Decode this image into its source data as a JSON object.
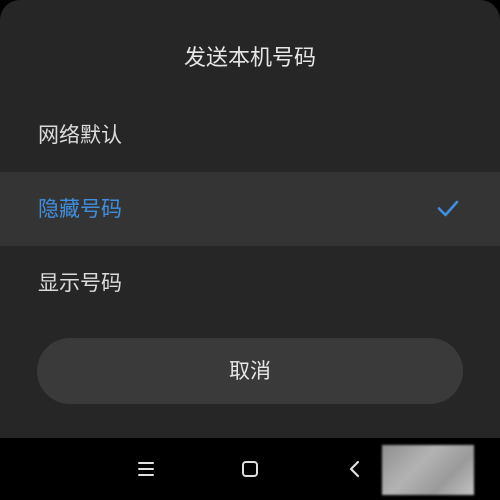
{
  "dialog": {
    "title": "发送本机号码",
    "options": [
      {
        "label": "网络默认",
        "selected": false
      },
      {
        "label": "隐藏号码",
        "selected": true
      },
      {
        "label": "显示号码",
        "selected": false
      }
    ],
    "cancel_label": "取消"
  },
  "navbar": {
    "icons": [
      "menu-icon",
      "home-square-icon",
      "back-chevron-icon"
    ]
  },
  "colors": {
    "dialog_bg": "#262626",
    "selected_row_bg": "#343434",
    "accent": "#3f8fe0",
    "text": "#dcdcdc",
    "button_bg": "#3a3a3a"
  }
}
